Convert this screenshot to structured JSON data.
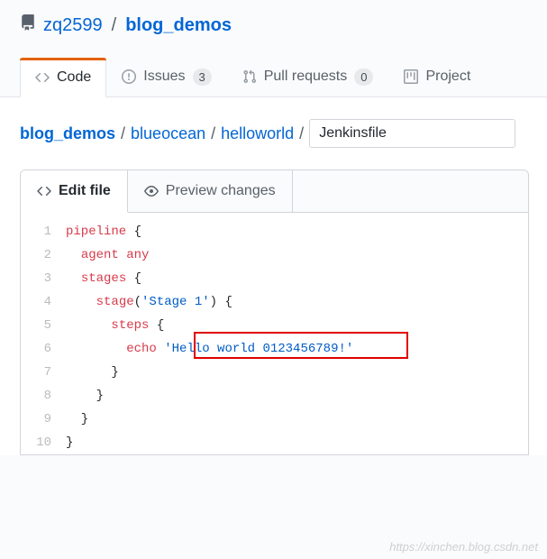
{
  "repo": {
    "owner": "zq2599",
    "name": "blog_demos"
  },
  "tabs": {
    "code": "Code",
    "issues": "Issues",
    "issues_count": "3",
    "pulls": "Pull requests",
    "pulls_count": "0",
    "projects": "Project"
  },
  "breadcrumb": {
    "root": "blog_demos",
    "p1": "blueocean",
    "p2": "helloworld",
    "filename": "Jenkinsfile"
  },
  "file_tabs": {
    "edit": "Edit file",
    "preview": "Preview changes"
  },
  "code": {
    "l1a": "pipeline",
    "l1b": " {",
    "l2a": "agent",
    "l2b": " ",
    "l2c": "any",
    "l3a": "stages",
    "l3b": " {",
    "l4a": "stage",
    "l4b": "(",
    "l4c": "'Stage 1'",
    "l4d": ") {",
    "l5a": "steps",
    "l5b": " {",
    "l6a": "echo",
    "l6b": " ",
    "l6c": "'Hello world 0123456789!'",
    "l7": "      }",
    "l8": "    }",
    "l9": "  }",
    "l10": "}"
  },
  "line_numbers": [
    "1",
    "2",
    "3",
    "4",
    "5",
    "6",
    "7",
    "8",
    "9",
    "10"
  ],
  "watermark": "https://xinchen.blog.csdn.net"
}
